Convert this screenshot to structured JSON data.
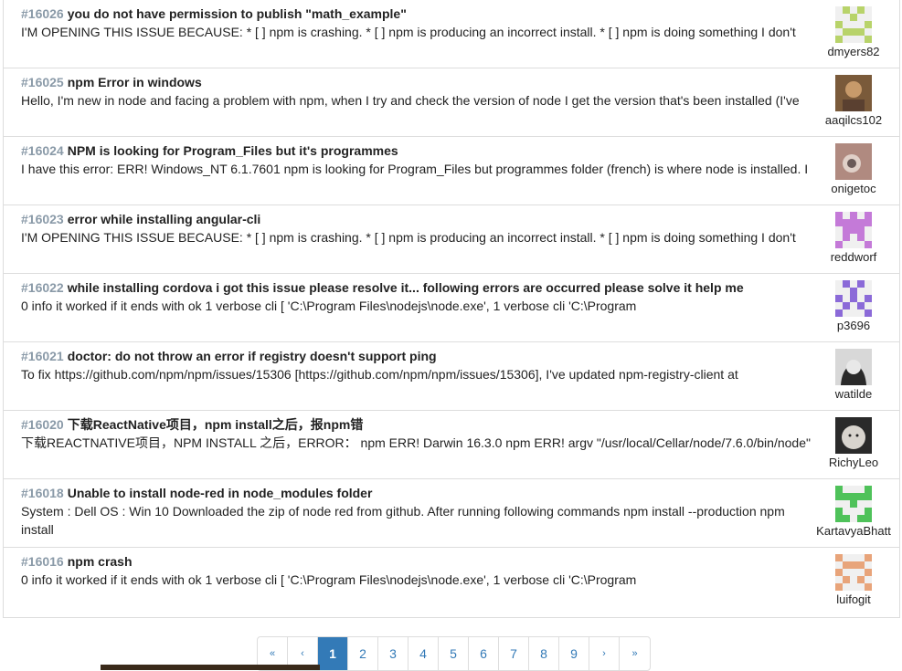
{
  "issues": [
    {
      "number": "#16026",
      "title": "you do not have permission to publish \"math_example\"",
      "snippet": "I'M OPENING THIS ISSUE BECAUSE: * [ ] npm is crashing. * [ ] npm is producing an incorrect install. * [ ] npm is doing something I don't",
      "user": "dmyers82",
      "avatar": "identicon-green"
    },
    {
      "number": "#16025",
      "title": "npm Error in windows",
      "snippet": "Hello, I'm new in node and facing a problem with npm, when I try and check the version of node I get the version that's been installed (I've",
      "user": "aaqilcs102",
      "avatar": "photo-person"
    },
    {
      "number": "#16024",
      "title": "NPM is looking for Program_Files but it's programmes",
      "snippet": "I have this error: ERR! Windows_NT 6.1.7601 npm is looking for Program_Files but programmes folder (french) is where node is installed. I",
      "user": "onigetoc",
      "avatar": "photo-camera"
    },
    {
      "number": "#16023",
      "title": "error while installing angular-cli",
      "snippet": "I'M OPENING THIS ISSUE BECAUSE: * [ ] npm is crashing. * [ ] npm is producing an incorrect install. * [ ] npm is doing something I don't",
      "user": "reddworf",
      "avatar": "identicon-purple"
    },
    {
      "number": "#16022",
      "title": "while installing cordova i got this issue please resolve it... following errors are occurred please solve it help me",
      "snippet": "0 info it worked if it ends with ok 1 verbose cli [ 'C:\\Program Files\\nodejs\\node.exe', 1 verbose cli 'C:\\Program",
      "user": "p3696",
      "avatar": "identicon-violet"
    },
    {
      "number": "#16021",
      "title": "doctor: do not throw an error if registry doesn't support ping",
      "snippet": "To fix https://github.com/npm/npm/issues/15306 [https://github.com/npm/npm/issues/15306], I've updated npm-registry-client at",
      "user": "watilde",
      "avatar": "photo-bw"
    },
    {
      "number": "#16020",
      "title": "下载ReactNative项目，npm install之后，报npm错",
      "snippet": "下载REACTNATIVE项目，NPM INSTALL 之后，ERROR： npm ERR! Darwin 16.3.0 npm ERR! argv \"/usr/local/Cellar/node/7.6.0/bin/node\"",
      "user": "RichyLeo",
      "avatar": "photo-dog"
    },
    {
      "number": "#16018",
      "title": "Unable to install node-red in node_modules folder",
      "snippet": "System : Dell OS : Win 10 Downloaded the zip of node red from github. After running following commands npm install --production npm install",
      "user": "KartavyaBhatt",
      "avatar": "identicon-green2"
    },
    {
      "number": "#16016",
      "title": "npm crash",
      "snippet": "0 info it worked if it ends with ok 1 verbose cli [ 'C:\\Program Files\\nodejs\\node.exe', 1 verbose cli 'C:\\Program",
      "user": "luifogit",
      "avatar": "identicon-orange"
    }
  ],
  "pagination": {
    "first": "«",
    "prev": "‹",
    "pages": [
      "1",
      "2",
      "3",
      "4",
      "5",
      "6",
      "7",
      "8",
      "9"
    ],
    "next": "›",
    "last": "»",
    "active": "1"
  },
  "colors": {
    "link": "#337ab7",
    "number": "#8a9aa8",
    "border": "#dddddd"
  }
}
